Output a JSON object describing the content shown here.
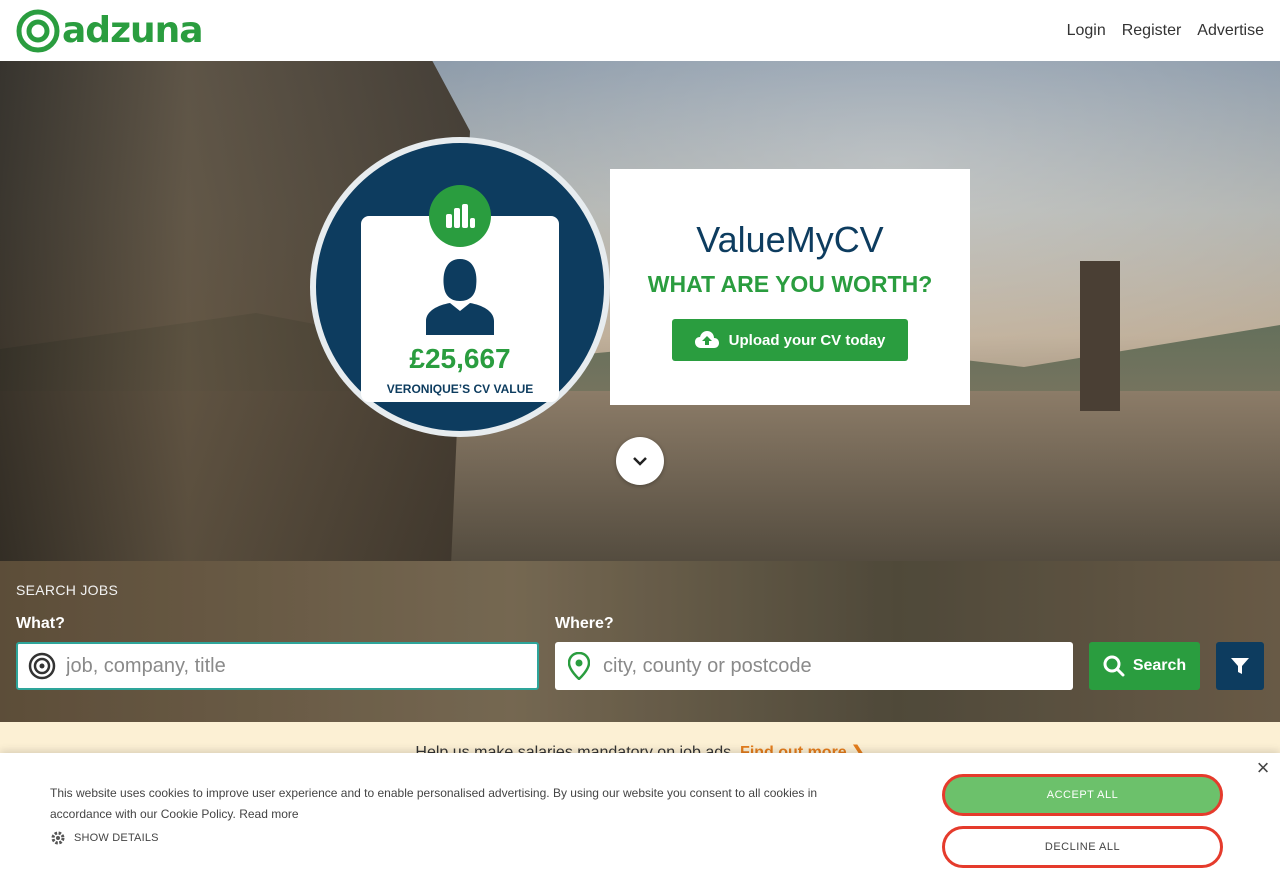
{
  "header": {
    "brand": "adzuna",
    "nav": [
      "Login",
      "Register",
      "Advertise"
    ]
  },
  "hero": {
    "cv_value": "£25,667",
    "cv_value_label": "VERONIQUE’S CV VALUE",
    "title": "ValueMyCV",
    "subtitle": "WHAT ARE YOU WORTH?",
    "upload_label": "Upload your CV today"
  },
  "search": {
    "heading": "SEARCH JOBS",
    "what_label": "What?",
    "what_placeholder": "job, company, title",
    "where_label": "Where?",
    "where_placeholder": "city, county or postcode",
    "search_label": "Search"
  },
  "banner": {
    "text": "Help us make salaries mandatory on job ads.",
    "link": "Find out more ❯"
  },
  "cookie": {
    "text": "This website uses cookies to improve user experience and to enable personalised advertising. By using our website you consent to all cookies in accordance with our Cookie Policy.",
    "read_more": "Read more",
    "show_details": "SHOW DETAILS",
    "accept": "ACCEPT ALL",
    "decline": "DECLINE ALL",
    "close": "×"
  },
  "colors": {
    "brand_green": "#2a9d3f",
    "navy": "#0d3c5f",
    "accent_orange": "#e47d1c"
  }
}
